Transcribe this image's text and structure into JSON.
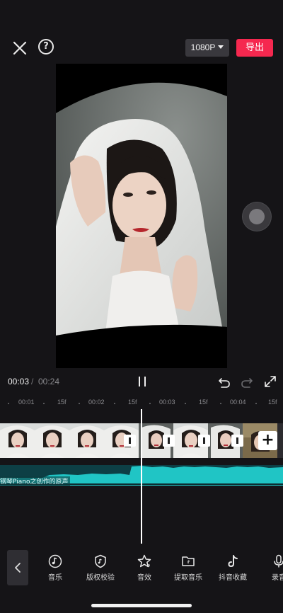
{
  "header": {
    "resolution_label": "1080P",
    "export_label": "导出",
    "help_label": "?"
  },
  "playback": {
    "current_time": "00:03",
    "separator": "/",
    "total_time": "00:24"
  },
  "timeline": {
    "ruler_labels": [
      "00:01",
      "15f",
      "00:02",
      "15f",
      "00:03",
      "15f",
      "00:04",
      "15f"
    ],
    "audio_track_label": "钢琴Piano之创作的原声",
    "add_clip_label": "+"
  },
  "toolbar": {
    "items": [
      {
        "label": "音乐",
        "icon": "music-note-icon"
      },
      {
        "label": "版权校验",
        "icon": "copyright-shield-icon"
      },
      {
        "label": "音效",
        "icon": "sound-effect-icon"
      },
      {
        "label": "提取音乐",
        "icon": "folder-extract-icon"
      },
      {
        "label": "抖音收藏",
        "icon": "tiktok-icon"
      },
      {
        "label": "录音",
        "icon": "microphone-icon"
      }
    ]
  },
  "colors": {
    "accent": "#f5284f",
    "background": "#151417",
    "audio_wave": "#20c5c5"
  }
}
